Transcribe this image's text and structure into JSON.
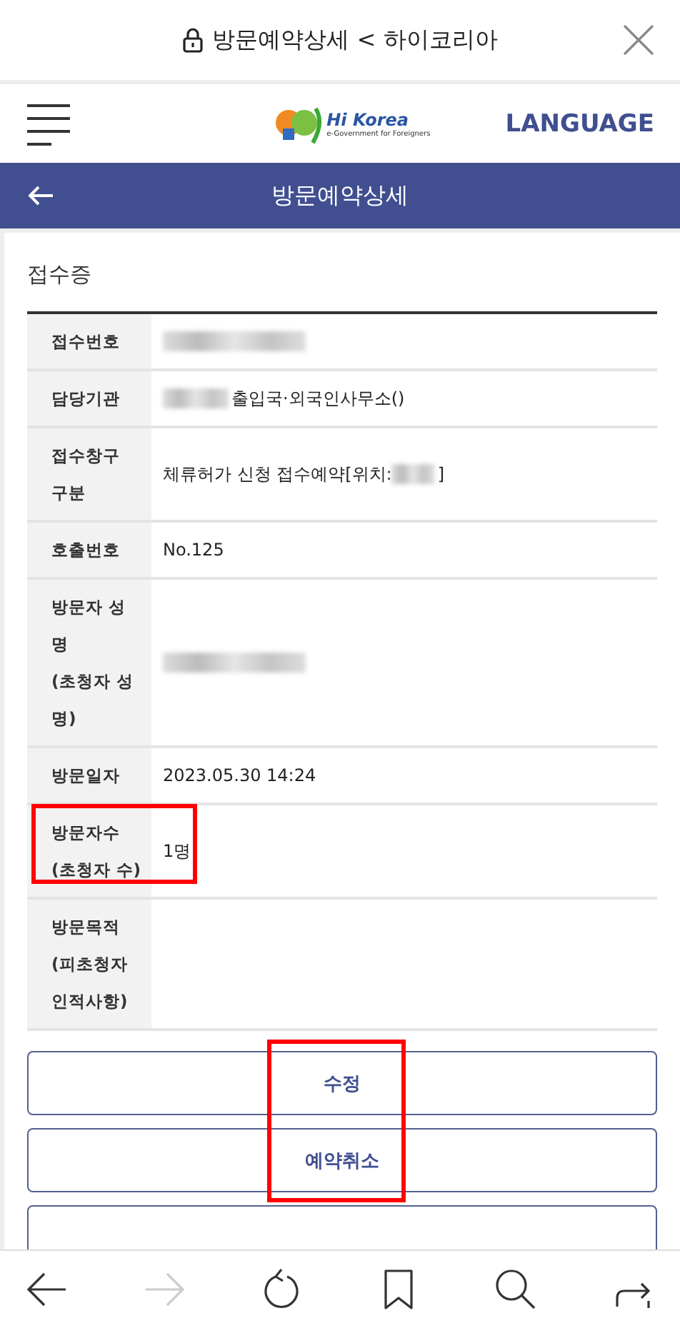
{
  "browser_bar": {
    "title": "방문예약상세 < 하이코리아",
    "secure": true
  },
  "header": {
    "logo_text": "Hi Korea",
    "logo_tagline": "e-Government for Foreigners",
    "language": "LANGUAGE"
  },
  "page_bar": {
    "title": "방문예약상세"
  },
  "section_title": "접수증",
  "rows": [
    {
      "label_lines": [
        "접수번호"
      ],
      "highlighted": false,
      "parts": [
        {
          "kind": "redacted"
        }
      ]
    },
    {
      "label_lines": [
        "담당기관"
      ],
      "highlighted": false,
      "parts": [
        {
          "kind": "redacted"
        },
        {
          "kind": "text",
          "text": "출입국·외국인사무소()"
        }
      ]
    },
    {
      "label_lines": [
        "접수창구",
        "구분"
      ],
      "highlighted": false,
      "parts": [
        {
          "kind": "text",
          "text": "체류허가 신청 접수예약[위치:"
        },
        {
          "kind": "redacted"
        },
        {
          "kind": "text",
          "text": "]"
        }
      ]
    },
    {
      "label_lines": [
        "호출번호"
      ],
      "highlighted": false,
      "parts": [
        {
          "kind": "text",
          "text": "No.125"
        }
      ]
    },
    {
      "label_lines": [
        "방문자 성",
        "명",
        "(초청자 성",
        "명)"
      ],
      "highlighted": false,
      "parts": [
        {
          "kind": "redacted"
        }
      ]
    },
    {
      "label_lines": [
        "방문일자"
      ],
      "highlighted": false,
      "parts": [
        {
          "kind": "text",
          "text": "2023.05.30 14:24"
        }
      ]
    },
    {
      "label_lines": [
        "방문자수",
        "(초청자 수)"
      ],
      "highlighted": true,
      "parts": [
        {
          "kind": "text",
          "text": "1명"
        }
      ]
    },
    {
      "label_lines": [
        "방문목적",
        "(피초청자",
        "인적사항)"
      ],
      "highlighted": false,
      "parts": []
    }
  ],
  "buttons": [
    {
      "label": "수정"
    },
    {
      "label": "예약취소"
    }
  ],
  "buttons_highlighted": true,
  "cut_off_button": true,
  "toolbar": [
    {
      "kind": "back",
      "disabled": false
    },
    {
      "kind": "forward",
      "disabled": true
    },
    {
      "kind": "reload",
      "disabled": false
    },
    {
      "kind": "bookmark",
      "disabled": false
    },
    {
      "kind": "search",
      "disabled": false
    },
    {
      "kind": "share",
      "disabled": false
    }
  ]
}
